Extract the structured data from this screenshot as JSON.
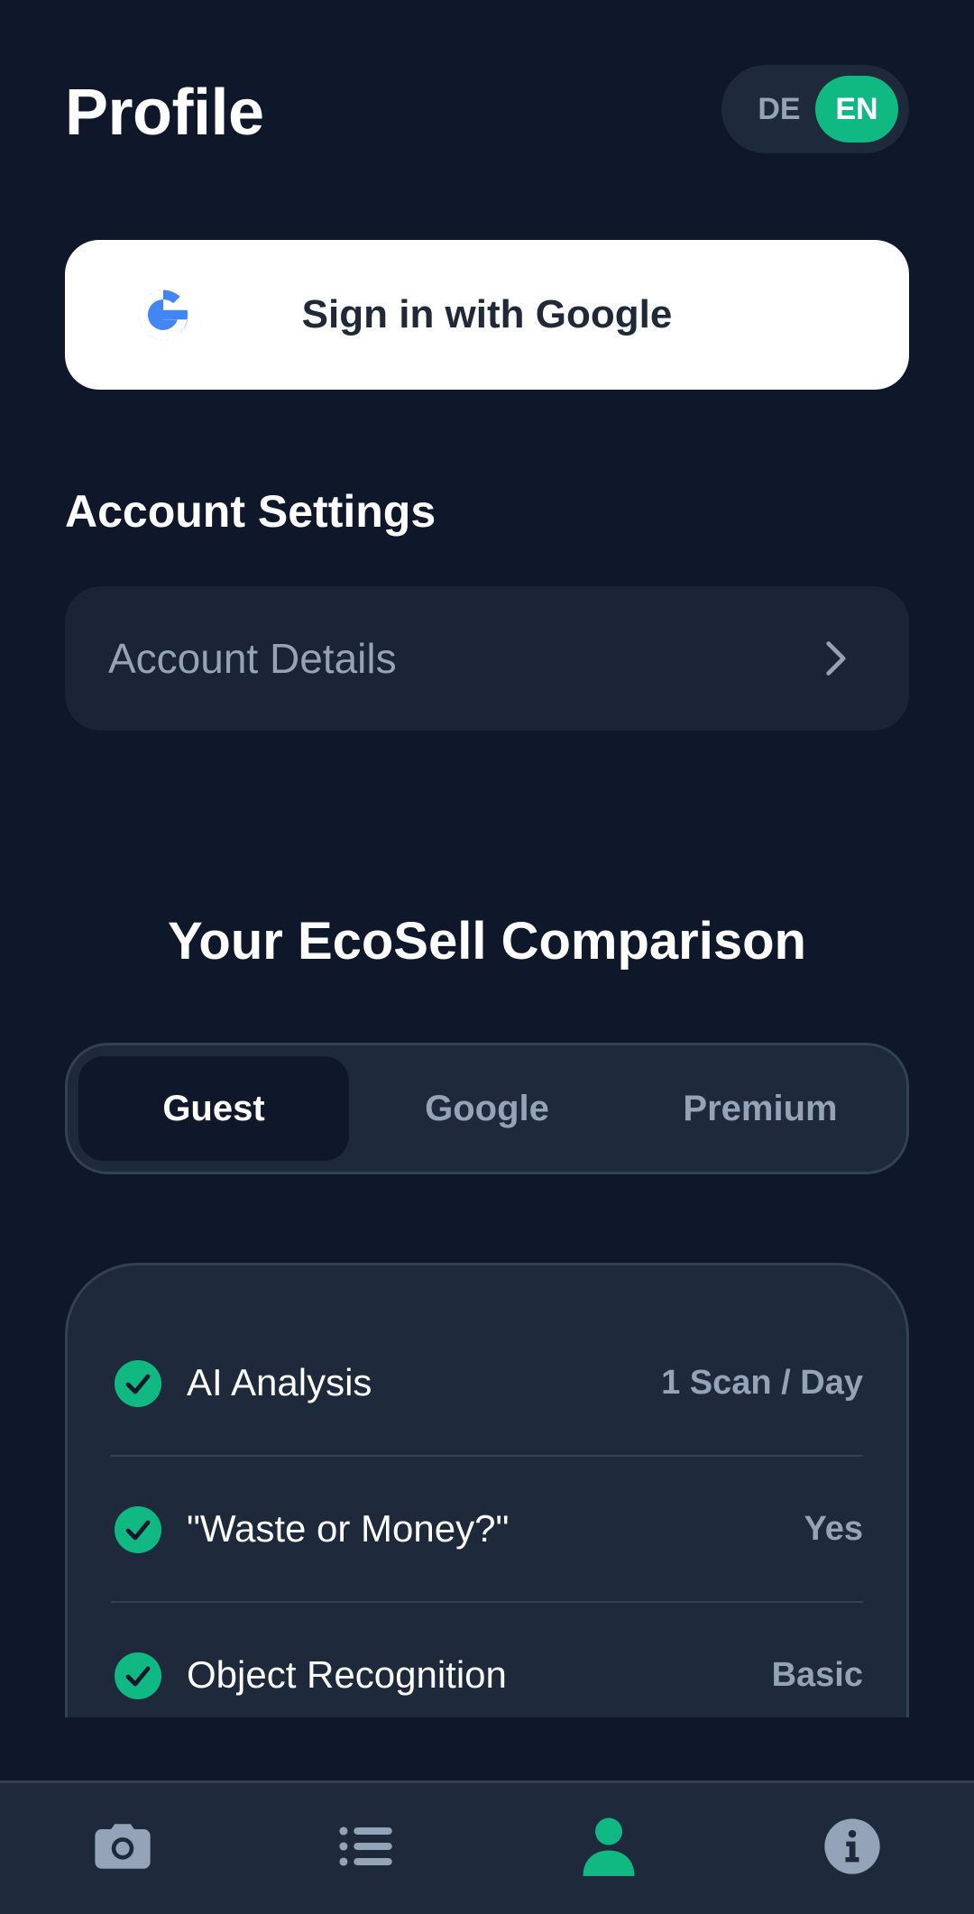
{
  "header": {
    "title": "Profile",
    "lang_de": "DE",
    "lang_en": "EN",
    "active_lang": "EN"
  },
  "google_signin": {
    "label": "Sign in with Google",
    "icon": "google-g-icon"
  },
  "account_settings": {
    "title": "Account Settings",
    "details_label": "Account Details"
  },
  "comparison": {
    "title": "Your EcoSell Comparison",
    "tabs": [
      {
        "label": "Guest",
        "active": true
      },
      {
        "label": "Google",
        "active": false
      },
      {
        "label": "Premium",
        "active": false
      }
    ],
    "features": [
      {
        "name": "AI Analysis",
        "value": "1 Scan / Day",
        "included": true
      },
      {
        "name": "\"Waste or Money?\"",
        "value": "Yes",
        "included": true
      },
      {
        "name": "Object Recognition",
        "value": "Basic",
        "included": true
      }
    ]
  },
  "bottom_nav": {
    "items": [
      {
        "icon": "camera-icon",
        "active": false
      },
      {
        "icon": "list-icon",
        "active": false
      },
      {
        "icon": "profile-icon",
        "active": true
      },
      {
        "icon": "info-icon",
        "active": false
      }
    ]
  },
  "colors": {
    "background": "#0f172a",
    "surface": "#1e293b",
    "accent": "#10b981",
    "muted_text": "#94a3b8",
    "google_blue": "#4285f4"
  }
}
